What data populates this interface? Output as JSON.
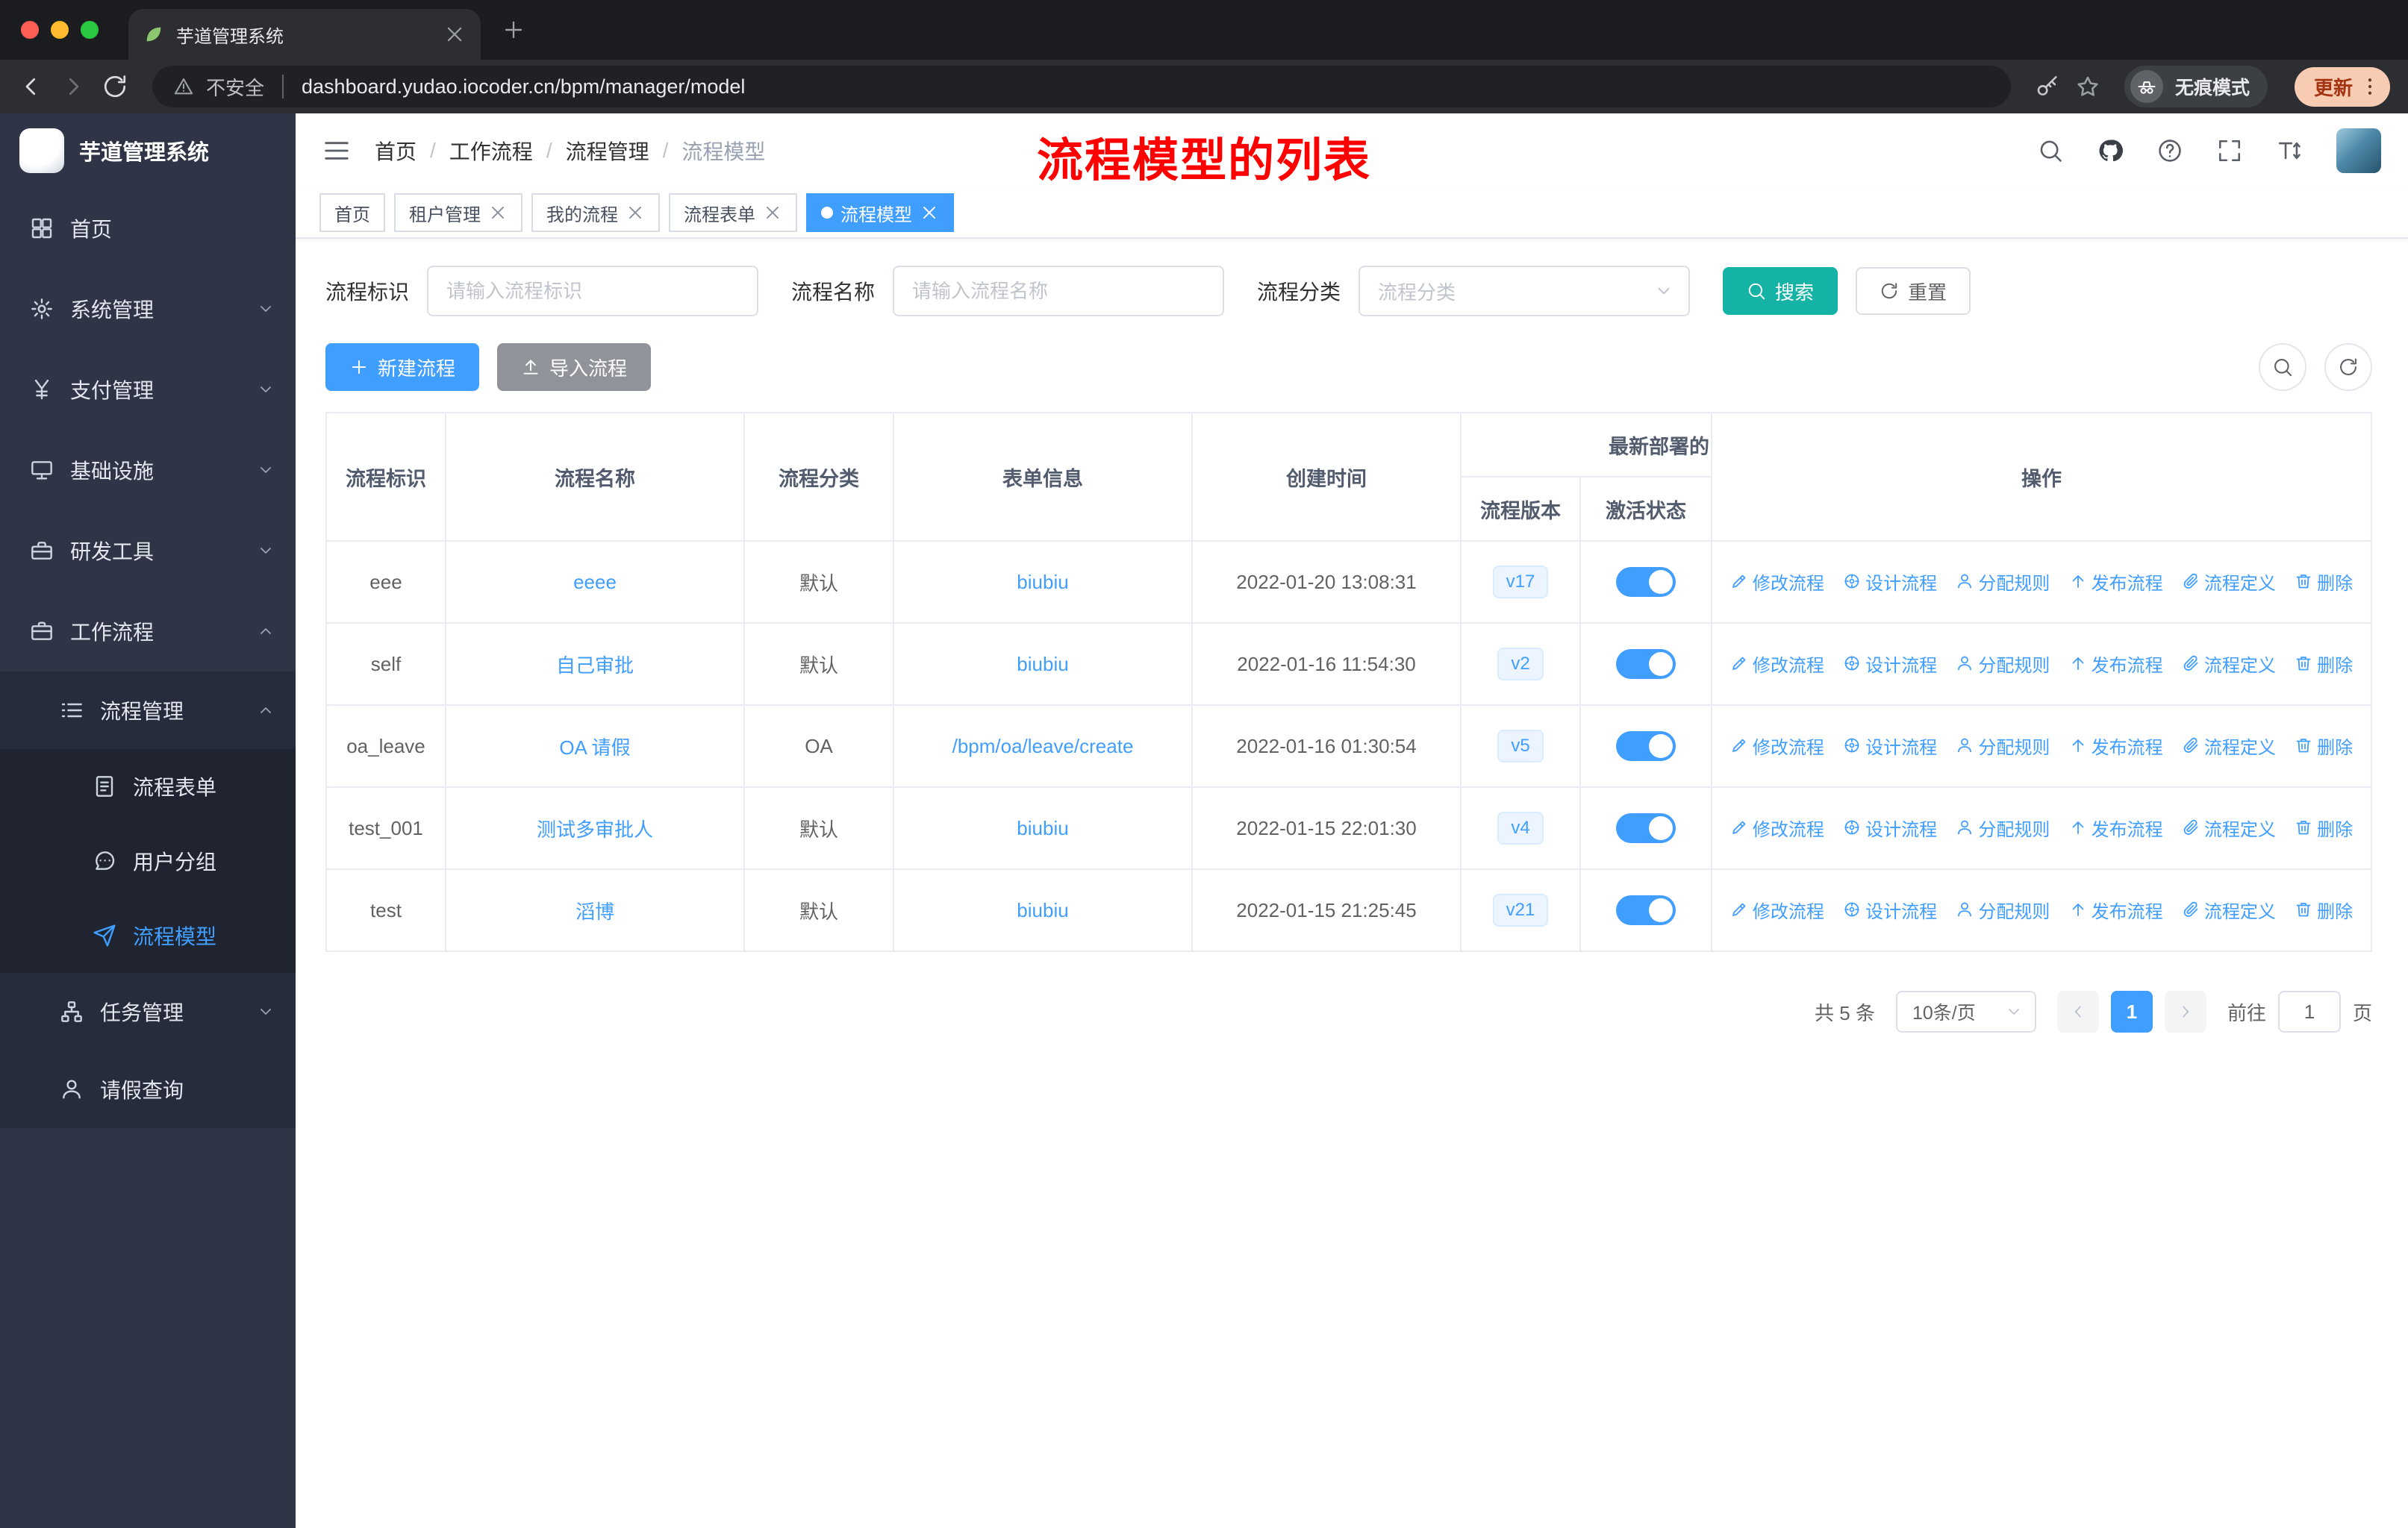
{
  "colors": {
    "accent": "#409eff",
    "search_button": "#14b3a6",
    "import_button": "#909399",
    "sidebar_bg": "#2f3447",
    "annotation_red": "#fe0000",
    "active_tag": "#409eff"
  },
  "browser": {
    "tab_title": "芋道管理系统",
    "security_label": "不安全",
    "url": "dashboard.yudao.iocoder.cn/bpm/manager/model",
    "incognito_label": "无痕模式",
    "update_label": "更新"
  },
  "sidebar": {
    "logo_title": "芋道管理系统",
    "menu": {
      "home": "首页",
      "system": "系统管理",
      "payment": "支付管理",
      "infra": "基础设施",
      "devtools": "研发工具",
      "workflow": "工作流程",
      "process_mgmt": "流程管理",
      "process_form": "流程表单",
      "user_group": "用户分组",
      "process_model": "流程模型",
      "task_mgmt": "任务管理",
      "leave_query": "请假查询"
    }
  },
  "header": {
    "breadcrumb": [
      "首页",
      "工作流程",
      "流程管理",
      "流程模型"
    ],
    "annotation": "流程模型的列表"
  },
  "tags": [
    {
      "label": "首页"
    },
    {
      "label": "租户管理"
    },
    {
      "label": "我的流程"
    },
    {
      "label": "流程表单"
    },
    {
      "label": "流程模型"
    }
  ],
  "filters": {
    "id_label": "流程标识",
    "id_placeholder": "请输入流程标识",
    "name_label": "流程名称",
    "name_placeholder": "请输入流程名称",
    "category_label": "流程分类",
    "category_placeholder": "流程分类",
    "search_label": "搜索",
    "reset_label": "重置"
  },
  "toolbar": {
    "create_label": "新建流程",
    "import_label": "导入流程"
  },
  "table": {
    "headers": {
      "id": "流程标识",
      "name": "流程名称",
      "category": "流程分类",
      "form": "表单信息",
      "created": "创建时间",
      "deploy_group": "最新部署的",
      "version": "流程版本",
      "status": "激活状态",
      "ops": "操作"
    },
    "op_labels": [
      "修改流程",
      "设计流程",
      "分配规则",
      "发布流程",
      "流程定义",
      "删除"
    ],
    "rows": [
      {
        "id": "eee",
        "name": "eeee",
        "category": "默认",
        "form": "biubiu",
        "created": "2022-01-20 13:08:31",
        "version": "v17",
        "active": true
      },
      {
        "id": "self",
        "name": "自己审批",
        "category": "默认",
        "form": "biubiu",
        "created": "2022-01-16 11:54:30",
        "version": "v2",
        "active": true
      },
      {
        "id": "oa_leave",
        "name": "OA 请假",
        "category": "OA",
        "form": "/bpm/oa/leave/create",
        "created": "2022-01-16 01:30:54",
        "version": "v5",
        "active": true
      },
      {
        "id": "test_001",
        "name": "测试多审批人",
        "category": "默认",
        "form": "biubiu",
        "created": "2022-01-15 22:01:30",
        "version": "v4",
        "active": true
      },
      {
        "id": "test",
        "name": "滔博",
        "category": "默认",
        "form": "biubiu",
        "created": "2022-01-15 21:25:45",
        "version": "v21",
        "active": true
      }
    ]
  },
  "pagination": {
    "total": "共 5 条",
    "page_size": "10条/页",
    "current_page": "1",
    "goto_label": "前往",
    "goto_value": "1",
    "page_unit": "页"
  }
}
